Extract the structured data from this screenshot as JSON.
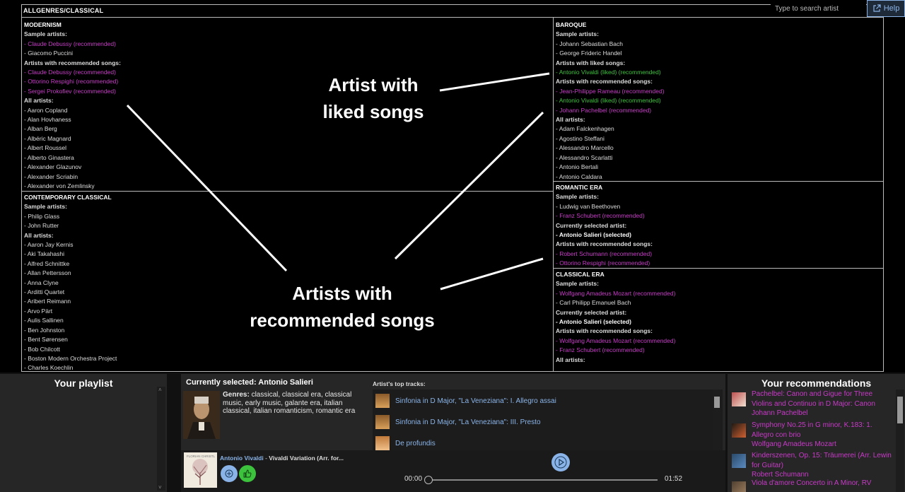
{
  "breadcrumb": "ALLGENRES/CLASSICAL",
  "search": {
    "placeholder": "Type to search artist"
  },
  "help": {
    "label": "Help"
  },
  "colors": {
    "recommended": "#c73bc7",
    "liked": "#3dc23d",
    "link": "#8ab4e8"
  },
  "panels": {
    "modernism": {
      "title": "MODERNISM",
      "lines": [
        {
          "t": "Sample artists:",
          "k": "sec"
        },
        {
          "t": "- Claude Debussy (recommended)",
          "k": "rec"
        },
        {
          "t": "- Giacomo Puccini",
          "k": "it"
        },
        {
          "t": "Artists with recommended songs:",
          "k": "sec"
        },
        {
          "t": "- Claude Debussy (recommended)",
          "k": "rec"
        },
        {
          "t": "- Ottorino Respighi (recommended)",
          "k": "rec"
        },
        {
          "t": "- Sergei Prokofiev (recommended)",
          "k": "rec"
        },
        {
          "t": "All artists:",
          "k": "sec"
        },
        {
          "t": "- Aaron Copland",
          "k": "it"
        },
        {
          "t": "- Alan Hovhaness",
          "k": "it"
        },
        {
          "t": "- Alban Berg",
          "k": "it"
        },
        {
          "t": "- Albéric Magnard",
          "k": "it"
        },
        {
          "t": "- Albert Roussel",
          "k": "it"
        },
        {
          "t": "- Alberto Ginastera",
          "k": "it"
        },
        {
          "t": "- Alexander Glazunov",
          "k": "it"
        },
        {
          "t": "- Alexander Scriabin",
          "k": "it"
        },
        {
          "t": "- Alexander von Zemlinsky",
          "k": "it"
        }
      ]
    },
    "contemporary": {
      "title": "CONTEMPORARY CLASSICAL",
      "lines": [
        {
          "t": "Sample artists:",
          "k": "sec"
        },
        {
          "t": "- Philip Glass",
          "k": "it"
        },
        {
          "t": "- John Rutter",
          "k": "it"
        },
        {
          "t": "All artists:",
          "k": "sec"
        },
        {
          "t": "- Aaron Jay Kernis",
          "k": "it"
        },
        {
          "t": "- Aki Takahashi",
          "k": "it"
        },
        {
          "t": "- Alfred Schnittke",
          "k": "it"
        },
        {
          "t": "- Allan Pettersson",
          "k": "it"
        },
        {
          "t": "- Anna Clyne",
          "k": "it"
        },
        {
          "t": "- Arditti Quartet",
          "k": "it"
        },
        {
          "t": "- Aribert Reimann",
          "k": "it"
        },
        {
          "t": "- Arvo Pärt",
          "k": "it"
        },
        {
          "t": "- Aulis Sallinen",
          "k": "it"
        },
        {
          "t": "- Ben Johnston",
          "k": "it"
        },
        {
          "t": "- Bent Sørensen",
          "k": "it"
        },
        {
          "t": "- Bob Chilcott",
          "k": "it"
        },
        {
          "t": "- Boston Modern Orchestra Project",
          "k": "it"
        },
        {
          "t": "- Charles Koechlin",
          "k": "it"
        }
      ]
    },
    "baroque": {
      "title": "BAROQUE",
      "lines": [
        {
          "t": "Sample artists:",
          "k": "sec"
        },
        {
          "t": "- Johann Sebastian Bach",
          "k": "it"
        },
        {
          "t": "- George Frideric Handel",
          "k": "it"
        },
        {
          "t": "Artists with liked songs:",
          "k": "sec"
        },
        {
          "t": "- Antonio Vivaldi (liked) (recommended)",
          "k": "liked"
        },
        {
          "t": "Artists with recommended songs:",
          "k": "sec"
        },
        {
          "t": "- Jean-Philippe Rameau (recommended)",
          "k": "rec"
        },
        {
          "t": "- Antonio Vivaldi (liked) (recommended)",
          "k": "liked"
        },
        {
          "t": "- Johann Pachelbel (recommended)",
          "k": "rec"
        },
        {
          "t": "All artists:",
          "k": "sec"
        },
        {
          "t": "- Adam Falckenhagen",
          "k": "it"
        },
        {
          "t": "- Agostino Steffani",
          "k": "it"
        },
        {
          "t": "- Alessandro Marcello",
          "k": "it"
        },
        {
          "t": "- Alessandro Scarlatti",
          "k": "it"
        },
        {
          "t": "- Antonio Bertali",
          "k": "it"
        },
        {
          "t": "- Antonio Caldara",
          "k": "it"
        }
      ]
    },
    "romantic": {
      "title": "ROMANTIC ERA",
      "lines": [
        {
          "t": "Sample artists:",
          "k": "sec"
        },
        {
          "t": "- Ludwig van Beethoven",
          "k": "it"
        },
        {
          "t": "- Franz Schubert (recommended)",
          "k": "rec"
        },
        {
          "t": "Currently selected artist:",
          "k": "sec"
        },
        {
          "t": "- Antonio Salieri (selected)",
          "k": "sel"
        },
        {
          "t": "Artists with recommended songs:",
          "k": "sec"
        },
        {
          "t": "- Robert Schumann (recommended)",
          "k": "rec"
        },
        {
          "t": "- Ottorino Respighi (recommended)",
          "k": "rec"
        }
      ]
    },
    "classical": {
      "title": "CLASSICAL ERA",
      "lines": [
        {
          "t": "Sample artists:",
          "k": "sec"
        },
        {
          "t": "- Wolfgang Amadeus Mozart (recommended)",
          "k": "rec"
        },
        {
          "t": "- Carl Philipp Emanuel Bach",
          "k": "it"
        },
        {
          "t": "Currently selected artist:",
          "k": "sec"
        },
        {
          "t": "- Antonio Salieri (selected)",
          "k": "sel"
        },
        {
          "t": "Artists with recommended songs:",
          "k": "sec"
        },
        {
          "t": "- Wolfgang Amadeus Mozart (recommended)",
          "k": "rec"
        },
        {
          "t": "- Franz Schubert (recommended)",
          "k": "rec"
        },
        {
          "t": "All artists:",
          "k": "sec"
        }
      ]
    }
  },
  "annotations": {
    "liked": [
      "Artist with",
      "liked songs"
    ],
    "recommended": [
      "Artists with",
      "recommended songs"
    ]
  },
  "playlist": {
    "title": "Your playlist"
  },
  "selected": {
    "heading": "Currently selected: Antonio Salieri",
    "genres_label": "Genres:",
    "genres_text": " classical, classical era, classical music, early music, galante era, italian classical, italian romanticism, romantic era",
    "top_tracks_label": "Artist's top tracks:",
    "tracks": [
      "Sinfonia in D Major, \"La Veneziana\": I. Allegro assai",
      "Sinfonia in D Major, \"La Veneziana\": III. Presto",
      "De profundis"
    ]
  },
  "player": {
    "album_caption": "FLORIAN CHRISTL",
    "artist": "Antonio Vivaldi",
    "separator": " - ",
    "track": "Vivaldi Variation (Arr. for...",
    "time_current": "00:00",
    "time_total": "01:52",
    "progress": 0.0
  },
  "recommendations": {
    "title": "Your recommendations",
    "items": [
      {
        "title": "Pachelbel: Canon and Gigue for Three Violins and Continuo in D Major: Canon",
        "artist": "Johann Pachelbel"
      },
      {
        "title": "Symphony No.25 in G minor, K.183: 1. Allegro con brio",
        "artist": "Wolfgang Amadeus Mozart"
      },
      {
        "title": "Kinderszenen, Op. 15: Träumerei (Arr. Lewin for Guitar)",
        "artist": "Robert Schumann"
      },
      {
        "title": "Viola d'amore Concerto in A Minor, RV",
        "artist": ""
      }
    ]
  }
}
